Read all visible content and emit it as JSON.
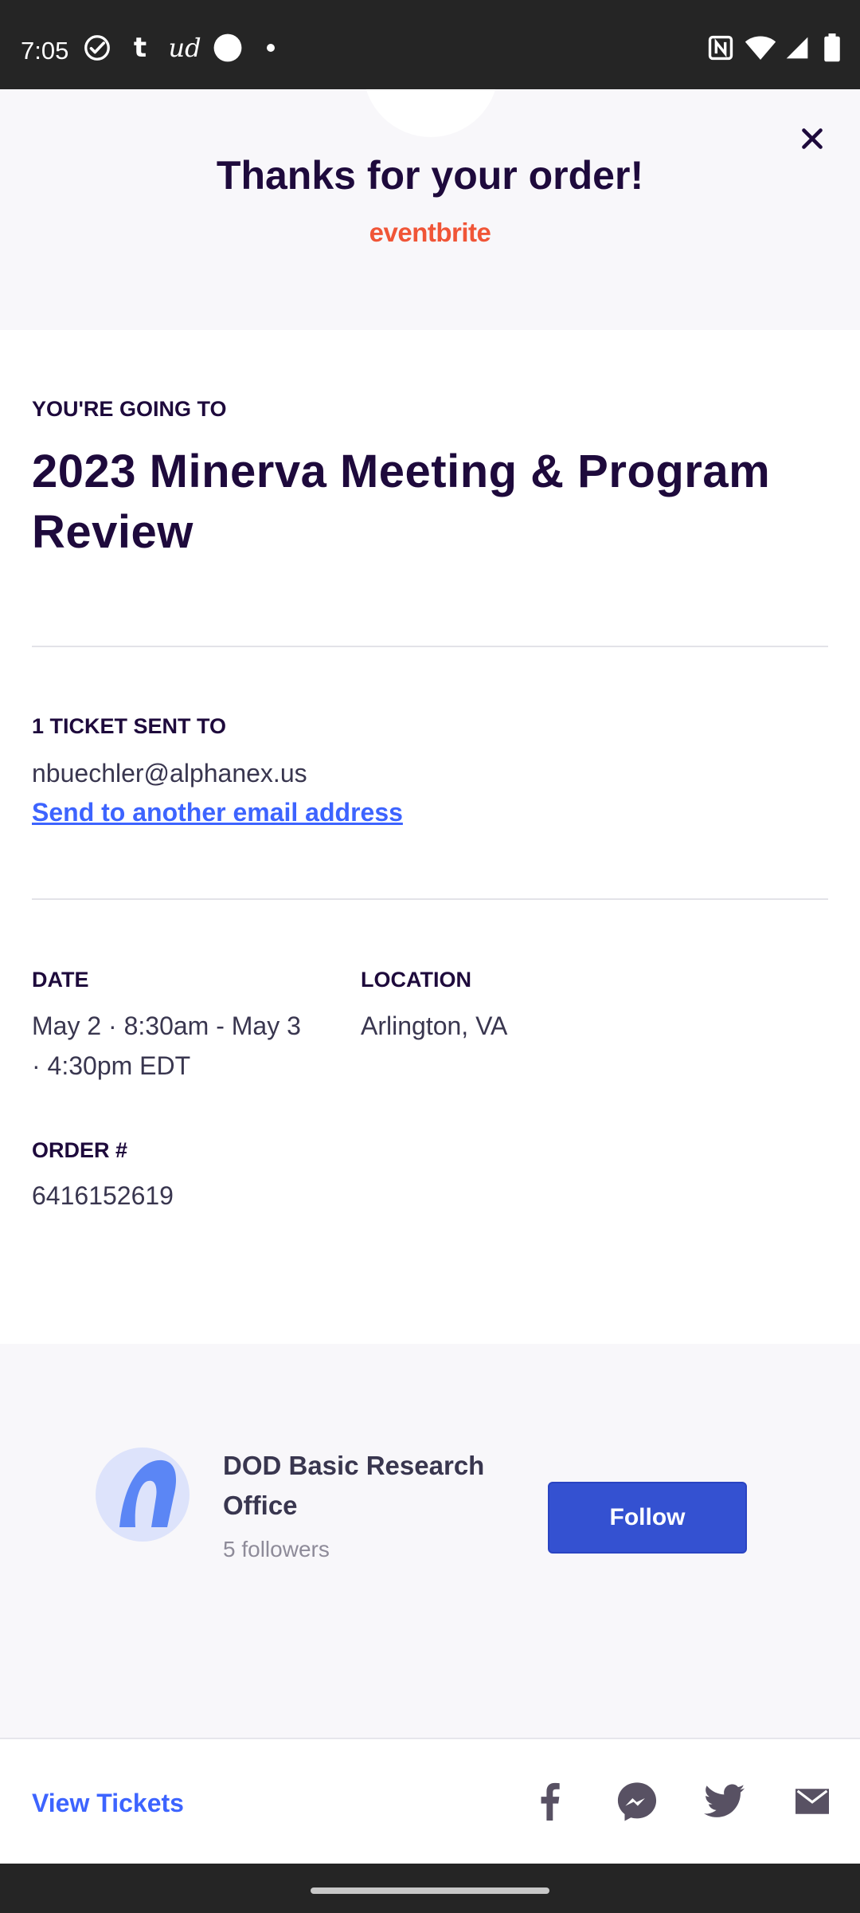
{
  "status_bar": {
    "time": "7:05",
    "icons_left": [
      "check-circle-icon",
      "tumblr-icon",
      "ud-icon",
      "circle-icon",
      "dot-icon"
    ],
    "tumblr_glyph": "t",
    "ud_glyph": "ud",
    "icons_right": [
      "nfc-icon",
      "wifi-icon",
      "signal-icon",
      "battery-icon"
    ]
  },
  "header": {
    "title": "Thanks for your order!",
    "brand": "eventbrite",
    "close_icon": "close-icon"
  },
  "event": {
    "going_label": "YOU'RE GOING TO",
    "title": "2023 Minerva Meeting & Program Review"
  },
  "ticket": {
    "sent_label": "1 TICKET SENT TO",
    "email": "nbuechler@alphanex.us",
    "send_link": "Send to another email address"
  },
  "details": {
    "date_label": "DATE",
    "date_value": "May 2 · 8:30am - May 3 · 4:30pm EDT",
    "location_label": "LOCATION",
    "location_value": "Arlington, VA",
    "order_label": "ORDER #",
    "order_value": "6416152619"
  },
  "organizer": {
    "name": "DOD Basic Research Office",
    "followers": "5 followers",
    "follow_label": "Follow"
  },
  "footer": {
    "view_tickets": "View Tickets",
    "share_icons": [
      "facebook-icon",
      "messenger-icon",
      "twitter-icon",
      "email-icon"
    ]
  },
  "colors": {
    "brand_orange": "#f05537",
    "link_blue": "#3d64ff",
    "follow_blue": "#3451d1",
    "title_dark": "#1e0a3c",
    "body_text": "#39364f",
    "muted": "#8e8b99",
    "panel_bg": "#f8f7fa"
  }
}
